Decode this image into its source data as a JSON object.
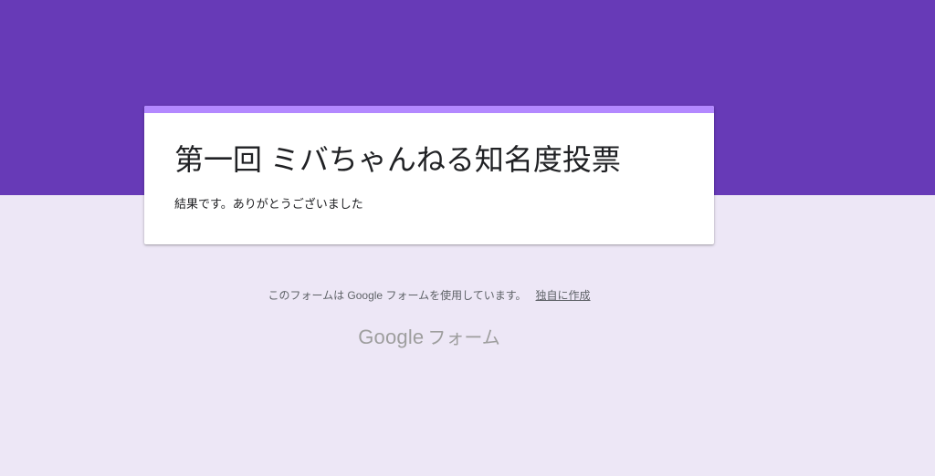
{
  "form": {
    "title": "第一回 ミバちゃんねる知名度投票",
    "description": "結果です。ありがとうございました"
  },
  "footer": {
    "note": "このフォームは Google フォームを使用しています。",
    "create_link": "独自に作成",
    "logo_google": "Google",
    "logo_forms": "フォーム"
  },
  "colors": {
    "header_band": "#673ab7",
    "page_background": "#ede7f6",
    "card_accent": "#b388ff"
  }
}
